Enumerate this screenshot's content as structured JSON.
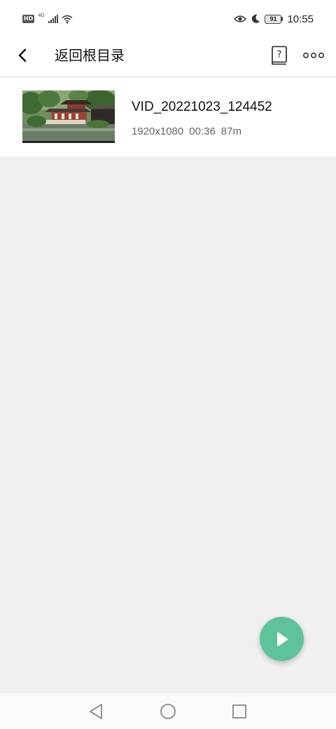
{
  "status_bar": {
    "hd_label": "HD",
    "network_label": "4G",
    "battery_level": "91",
    "time": "10:55",
    "icons": [
      "signal-icon",
      "wifi-icon",
      "eye-icon",
      "moon-icon",
      "battery-icon"
    ]
  },
  "app_bar": {
    "title": "返回根目录",
    "help_icon_glyph": "?",
    "icons": [
      "back-arrow-icon",
      "help-book-icon",
      "more-dots-icon"
    ]
  },
  "files": [
    {
      "name": "VID_20221023_124452",
      "resolution": "1920x1080",
      "duration": "00:36",
      "size": "87m",
      "thumbnail": "pagoda-garden-pond-thumbnail"
    }
  ],
  "fab": {
    "icon": "play-icon",
    "color": "#5ec39a"
  },
  "nav_bar": {
    "icons": [
      "nav-back-icon",
      "nav-home-icon",
      "nav-recents-icon"
    ]
  }
}
